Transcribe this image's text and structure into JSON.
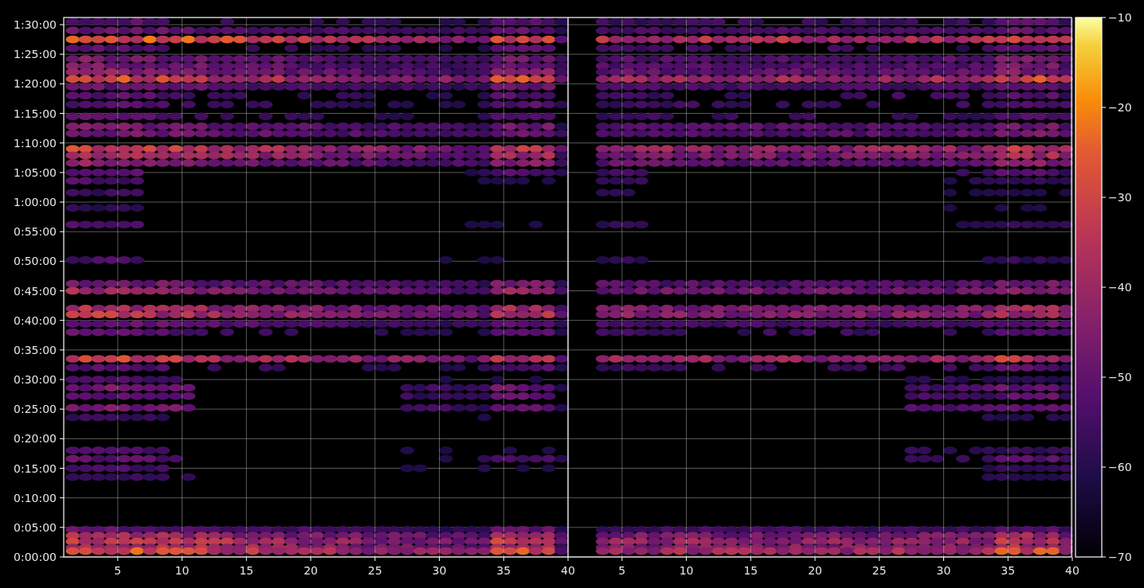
{
  "plot": {
    "y_ticks": [
      "1:30:00",
      "1:25:00",
      "1:20:00",
      "1:15:00",
      "1:10:00",
      "1:05:00",
      "1:00:00",
      "0:55:00",
      "0:50:00",
      "0:45:00",
      "0:40:00",
      "0:35:00",
      "0:30:00",
      "0:25:00",
      "0:20:00",
      "0:15:00",
      "0:10:00",
      "0:05:00",
      "0:00:00"
    ],
    "panels": [
      {
        "x_ticks": [
          "5",
          "10",
          "15",
          "20",
          "25",
          "30",
          "35",
          "40"
        ]
      },
      {
        "x_ticks": [
          "5",
          "10",
          "15",
          "20",
          "25",
          "30",
          "35",
          "40"
        ]
      }
    ],
    "colorbar": {
      "ticks": [
        "−10",
        "−20",
        "−30",
        "−40",
        "−50",
        "−60",
        "−70"
      ]
    }
  }
}
